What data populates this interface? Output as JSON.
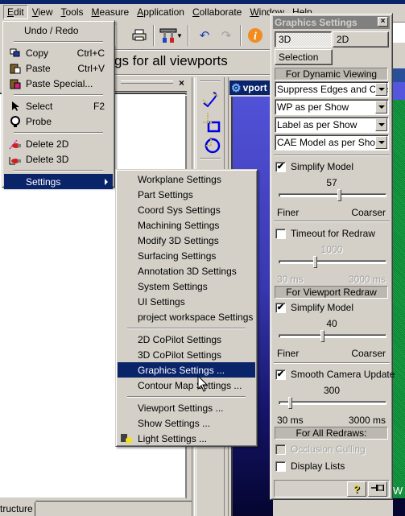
{
  "menubar": {
    "items": [
      {
        "label": "Edit",
        "accel": "E",
        "rest": "dit"
      },
      {
        "label": "View",
        "accel": "V",
        "rest": "iew"
      },
      {
        "label": "Tools",
        "accel": "T",
        "rest": "ools"
      },
      {
        "label": "Measure",
        "accel": "M",
        "rest": "easure"
      },
      {
        "label": "Application",
        "accel": "A",
        "rest": "pplication"
      },
      {
        "label": "Collaborate",
        "accel": "C",
        "rest": "ollaborate"
      },
      {
        "label": "Window",
        "accel": "W",
        "rest": "indow"
      },
      {
        "label": "Help",
        "accel": "H",
        "rest": "elp"
      }
    ]
  },
  "toolbar": {
    "icons": [
      "printer-icon",
      "tools-icon",
      "undo-icon",
      "redo-icon",
      "info-icon"
    ]
  },
  "hint_text": "gs for all viewports",
  "left_panel": {
    "close_glyph": "×",
    "tab_label": "tructure"
  },
  "viewport": {
    "title": "vport",
    "edge_text": "W"
  },
  "edit_menu": {
    "undo_redo": "Undo / Redo",
    "copy": {
      "label": "Copy",
      "shortcut": "Ctrl+C"
    },
    "paste": {
      "label": "Paste",
      "shortcut": "Ctrl+V"
    },
    "paste_special": "Paste Special...",
    "select": {
      "label": "Select",
      "shortcut": "F2"
    },
    "probe": "Probe",
    "delete_2d": "Delete 2D",
    "delete_3d": "Delete 3D",
    "settings": "Settings"
  },
  "settings_menu": {
    "group1": [
      "Workplane Settings",
      "Part Settings",
      "Coord Sys Settings",
      "Machining Settings",
      "Modify 3D Settings",
      "Surfacing Settings",
      "Annotation 3D Settings",
      "System Settings",
      "UI Settings",
      "project workspace Settings"
    ],
    "group2": [
      "2D CoPilot Settings",
      "3D CoPilot Settings",
      "Graphics Settings ...",
      "Contour Map Settings ..."
    ],
    "group3": [
      "Viewport Settings ...",
      "Show Settings ...",
      "Light Settings ..."
    ],
    "highlighted": "Graphics Settings ..."
  },
  "graphics_settings": {
    "title": "Graphics Settings",
    "close_glyph": "×",
    "tab_3d": "3D",
    "tab_2d": "2D",
    "selection_button": "Selection",
    "dynamic_header": "For Dynamic Viewing",
    "dropdowns": [
      "Suppress Edges and Caps",
      "WP as per Show",
      "Label as per Show",
      "CAE Model as per Show"
    ],
    "dynamic_simplify": {
      "label": "Simplify Model",
      "checked": true,
      "value": "57",
      "fraction": 0.57,
      "min_label": "Finer",
      "max_label": "Coarser"
    },
    "timeout": {
      "label": "Timeout for Redraw",
      "checked": false,
      "value": "1000",
      "fraction": 0.33,
      "min_label": "30 ms",
      "max_label": "3000 ms"
    },
    "viewport_header": "For Viewport Redraw",
    "viewport_simplify": {
      "label": "Simplify Model",
      "checked": true,
      "value": "40",
      "fraction": 0.4,
      "min_label": "Finer",
      "max_label": "Coarser"
    },
    "smooth_camera": {
      "label": "Smooth Camera Update",
      "checked": true,
      "value": "300",
      "fraction": 0.09,
      "min_label": "30 ms",
      "max_label": "3000 ms"
    },
    "all_redraws_header": "For All Redraws:",
    "occlusion_culling": {
      "label": "Occlusion Culling",
      "checked": false,
      "disabled": true
    },
    "display_lists": {
      "label": "Display Lists",
      "checked": false
    },
    "help_glyph": "?",
    "pin_glyph": "⊣"
  }
}
